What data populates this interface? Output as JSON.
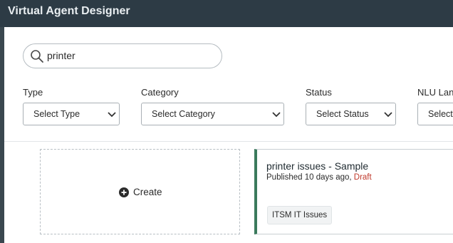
{
  "app": {
    "title": "Virtual Agent Designer"
  },
  "search": {
    "value": "printer",
    "icon": "search-icon"
  },
  "filters": [
    {
      "label": "Type",
      "selected": "Select Type"
    },
    {
      "label": "Category",
      "selected": "Select Category"
    },
    {
      "label": "Status",
      "selected": "Select Status"
    },
    {
      "label": "NLU Lang",
      "selected": "Select"
    }
  ],
  "create_card": {
    "label": "Create",
    "icon": "plus-circle-icon"
  },
  "topic_card": {
    "title": "printer issues - Sample",
    "status": "Published",
    "age": "10 days ago,",
    "draft": "Draft",
    "tag": "ITSM IT Issues",
    "accent_color": "#3a7a5c",
    "draft_color": "#c0392b"
  }
}
